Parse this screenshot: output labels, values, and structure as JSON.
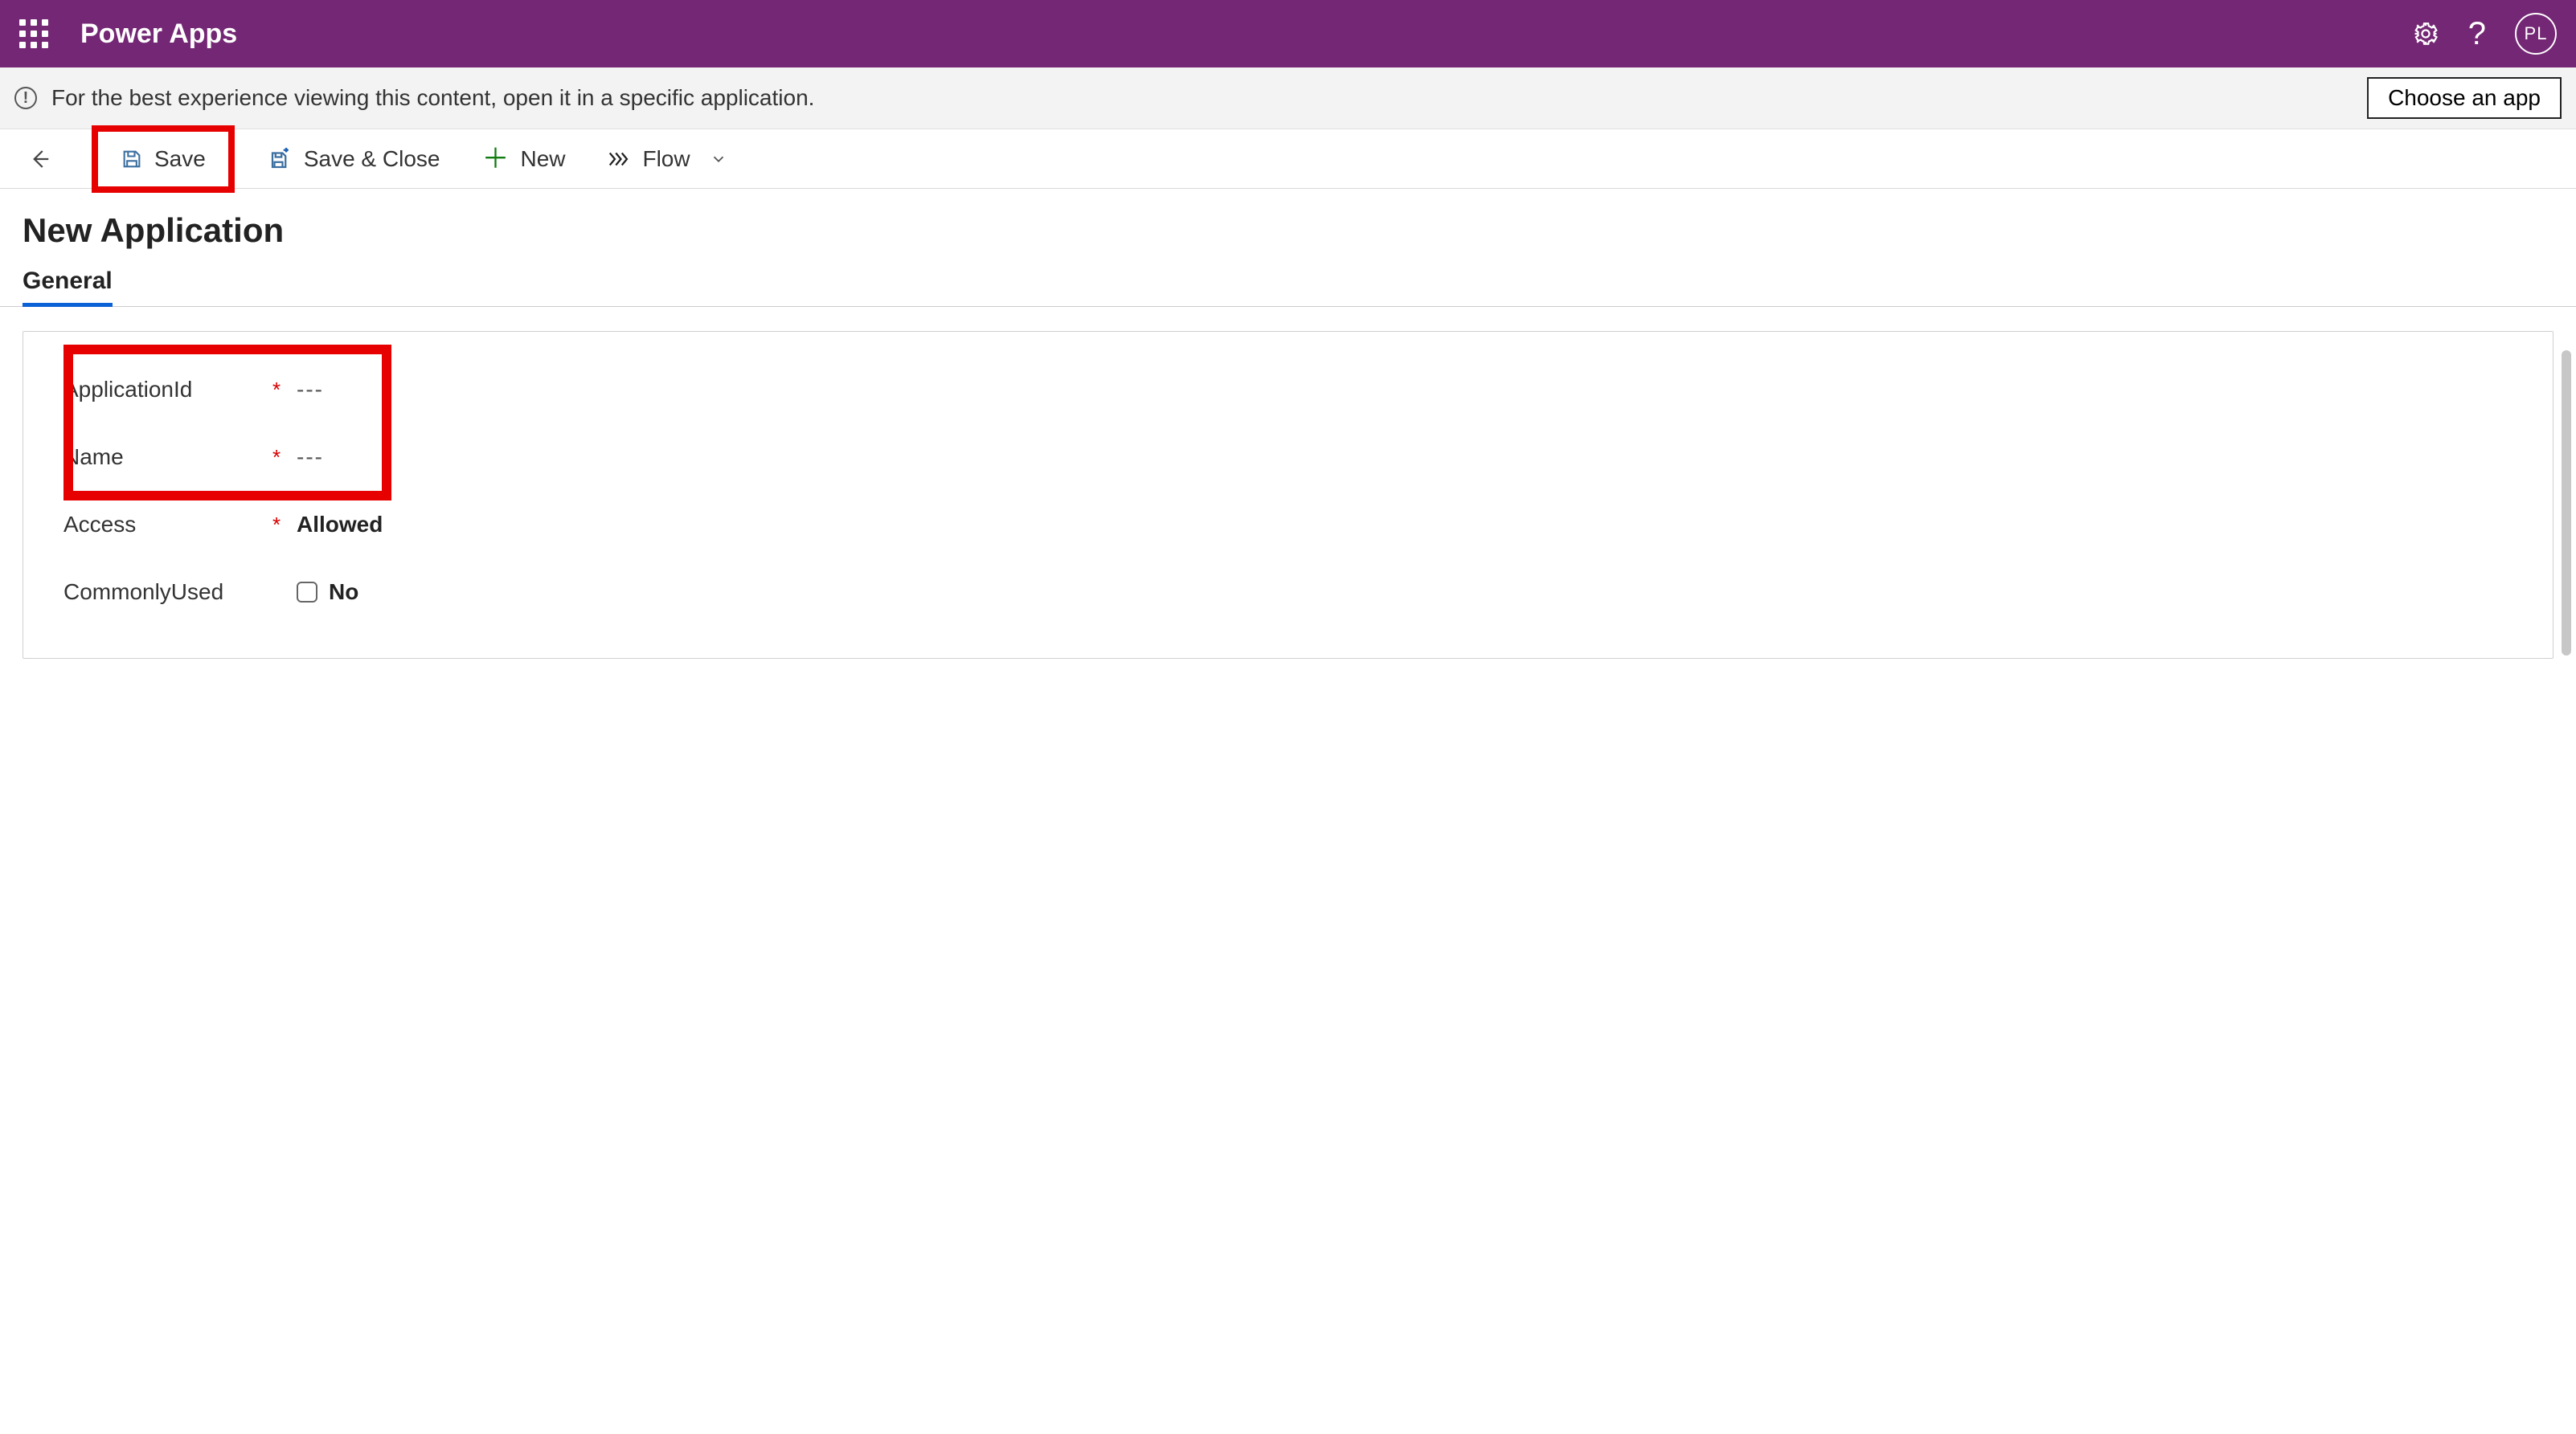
{
  "header": {
    "app_name": "Power Apps",
    "avatar_initials": "PL"
  },
  "notice": {
    "message": "For the best experience viewing this content, open it in a specific application.",
    "choose_label": "Choose an app"
  },
  "cmdbar": {
    "save": "Save",
    "save_close": "Save & Close",
    "new": "New",
    "flow": "Flow"
  },
  "form": {
    "title": "New Application",
    "tab": "General",
    "fields": {
      "application_id": {
        "label": "ApplicationId",
        "required": true,
        "value": "---"
      },
      "name": {
        "label": "Name",
        "required": true,
        "value": "---"
      },
      "access": {
        "label": "Access",
        "required": true,
        "value": "Allowed"
      },
      "commonly_used": {
        "label": "CommonlyUsed",
        "required": false,
        "value": "No",
        "checked": false
      }
    }
  }
}
